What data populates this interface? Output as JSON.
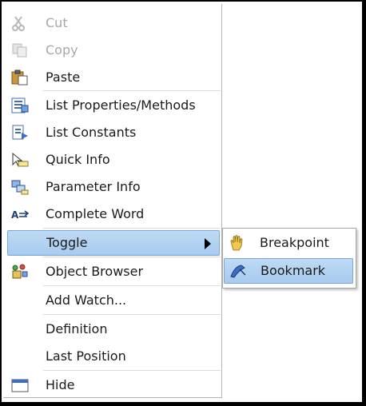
{
  "context_menu": {
    "items": [
      {
        "name": "cut",
        "label": "Cut",
        "enabled": false,
        "icon": "scissors-icon"
      },
      {
        "name": "copy",
        "label": "Copy",
        "enabled": false,
        "icon": "copy-icon"
      },
      {
        "name": "paste",
        "label": "Paste",
        "enabled": true,
        "icon": "paste-icon"
      },
      {
        "name": "list-properties-methods",
        "label": "List Properties/Methods",
        "enabled": true,
        "icon": "list-properties-icon"
      },
      {
        "name": "list-constants",
        "label": "List Constants",
        "enabled": true,
        "icon": "list-constants-icon"
      },
      {
        "name": "quick-info",
        "label": "Quick Info",
        "enabled": true,
        "icon": "quick-info-icon"
      },
      {
        "name": "parameter-info",
        "label": "Parameter Info",
        "enabled": true,
        "icon": "parameter-info-icon"
      },
      {
        "name": "complete-word",
        "label": "Complete Word",
        "enabled": true,
        "icon": "complete-word-icon"
      },
      {
        "name": "toggle",
        "label": "Toggle",
        "enabled": true,
        "highlighted": true,
        "has_submenu": true
      },
      {
        "name": "object-browser",
        "label": "Object Browser",
        "enabled": true,
        "icon": "object-browser-icon"
      },
      {
        "name": "add-watch",
        "label": "Add Watch...",
        "enabled": true
      },
      {
        "name": "definition",
        "label": "Definition",
        "enabled": true
      },
      {
        "name": "last-position",
        "label": "Last Position",
        "enabled": true
      },
      {
        "name": "hide",
        "label": "Hide",
        "enabled": true,
        "icon": "window-icon"
      }
    ]
  },
  "submenu": {
    "items": [
      {
        "name": "breakpoint",
        "label": "Breakpoint",
        "icon": "hand-icon"
      },
      {
        "name": "bookmark",
        "label": "Bookmark",
        "icon": "bookmark-icon",
        "highlighted": true
      }
    ]
  },
  "colors": {
    "highlight": "#b2d3f3",
    "highlight_border": "#7aa7d6",
    "disabled_text": "#a8a8a8",
    "separator": "#dcdcdc"
  }
}
